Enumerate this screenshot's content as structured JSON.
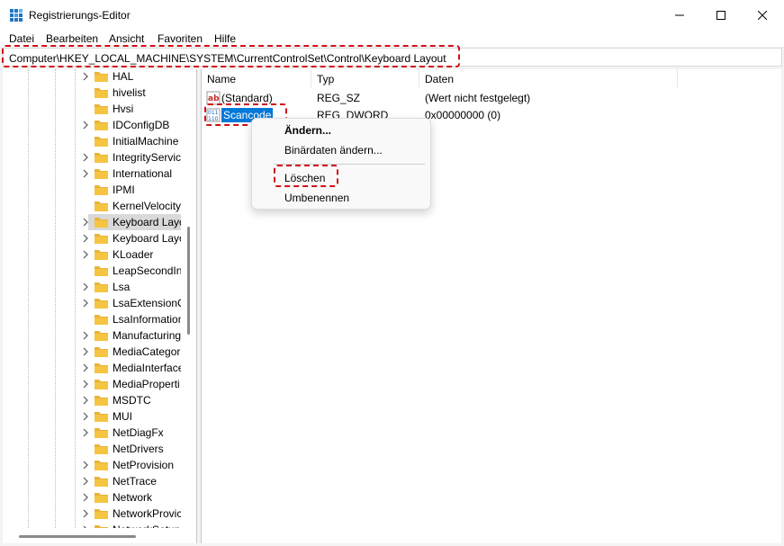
{
  "window": {
    "title": "Registrierungs-Editor"
  },
  "menu": [
    "Datei",
    "Bearbeiten",
    "Ansicht",
    "Favoriten",
    "Hilfe"
  ],
  "address": {
    "path": "Computer\\HKEY_LOCAL_MACHINE\\SYSTEM\\CurrentControlSet\\Control\\Keyboard Layout"
  },
  "tree": {
    "items": [
      {
        "label": "HAL",
        "expandable": true
      },
      {
        "label": "hivelist",
        "expandable": false
      },
      {
        "label": "Hvsi",
        "expandable": false
      },
      {
        "label": "IDConfigDB",
        "expandable": true
      },
      {
        "label": "InitialMachine",
        "expandable": false
      },
      {
        "label": "IntegrityServic",
        "expandable": true
      },
      {
        "label": "International",
        "expandable": true
      },
      {
        "label": "IPMI",
        "expandable": false
      },
      {
        "label": "KernelVelocity",
        "expandable": false
      },
      {
        "label": "Keyboard Layo",
        "expandable": true,
        "selected": true
      },
      {
        "label": "Keyboard Layo",
        "expandable": true
      },
      {
        "label": "KLoader",
        "expandable": true
      },
      {
        "label": "LeapSecondIn",
        "expandable": false
      },
      {
        "label": "Lsa",
        "expandable": true
      },
      {
        "label": "LsaExtensionC",
        "expandable": true
      },
      {
        "label": "LsaInformation",
        "expandable": false
      },
      {
        "label": "Manufacturing",
        "expandable": true
      },
      {
        "label": "MediaCategor",
        "expandable": true
      },
      {
        "label": "MediaInterface",
        "expandable": true
      },
      {
        "label": "MediaProperti",
        "expandable": true
      },
      {
        "label": "MSDTC",
        "expandable": true
      },
      {
        "label": "MUI",
        "expandable": true
      },
      {
        "label": "NetDiagFx",
        "expandable": true
      },
      {
        "label": "NetDrivers",
        "expandable": false
      },
      {
        "label": "NetProvision",
        "expandable": true
      },
      {
        "label": "NetTrace",
        "expandable": true
      },
      {
        "label": "Network",
        "expandable": true
      },
      {
        "label": "NetworkProvic",
        "expandable": true
      },
      {
        "label": "NetworkSetup",
        "expandable": true
      }
    ]
  },
  "list": {
    "headers": {
      "name": "Name",
      "type": "Typ",
      "data": "Daten"
    },
    "rows": [
      {
        "icon": "string-value-icon",
        "name": "(Standard)",
        "type": "REG_SZ",
        "data": "(Wert nicht festgelegt)"
      },
      {
        "icon": "binary-value-icon",
        "name": "Scancode",
        "type": "REG_DWORD",
        "data": "0x00000000 (0)",
        "selected": true
      }
    ]
  },
  "context_menu": {
    "items": [
      "Ändern...",
      "Binärdaten ändern...",
      "Löschen",
      "Umbenennen"
    ]
  },
  "colors": {
    "selection": "#0078d7",
    "highlight": "#d20f18",
    "folder": "#f5c542"
  }
}
